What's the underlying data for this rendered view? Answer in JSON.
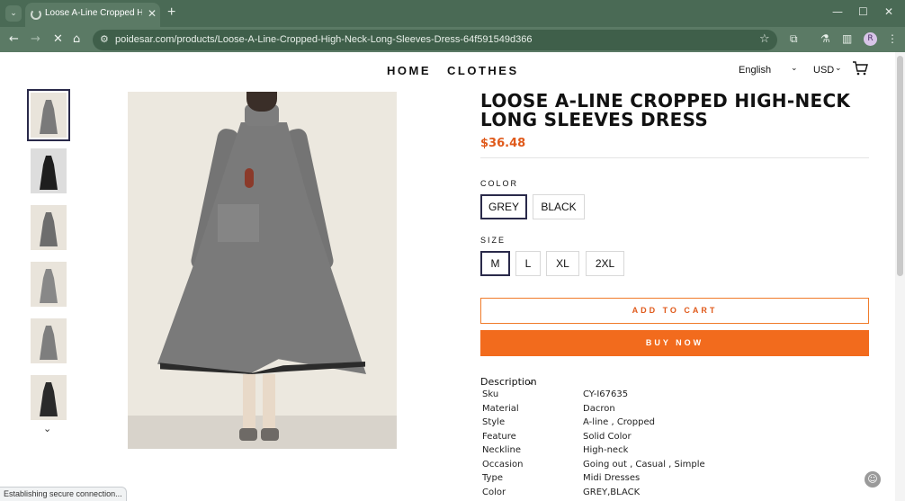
{
  "browser": {
    "tab_title": "Loose A-Line Cropped High-N",
    "tab_close": "✕",
    "new_tab": "+",
    "url": "poidesar.com/products/Loose-A-Line-Cropped-High-Neck-Long-Sleeves-Dress-64f591549d366",
    "profile_initial": "R",
    "status_text": "Establishing secure connection..."
  },
  "nav": {
    "items": [
      "HOME",
      "CLOTHES"
    ],
    "language": "English",
    "currency": "USD"
  },
  "product": {
    "title": "LOOSE A-LINE CROPPED HIGH-NECK LONG SLEEVES DRESS",
    "price": "$36.48",
    "color_label": "COLOR",
    "colors": [
      "GREY",
      "BLACK"
    ],
    "selected_color": "GREY",
    "size_label": "SIZE",
    "sizes": [
      "M",
      "L",
      "XL",
      "2XL"
    ],
    "selected_size": "M",
    "add_to_cart": "ADD TO CART",
    "buy_now": "BUY NOW",
    "description_label": "Description",
    "specs": [
      {
        "key": "Sku",
        "value": "CY-I67635"
      },
      {
        "key": "Material",
        "value": "Dacron"
      },
      {
        "key": "Style",
        "value": "A-line , Cropped"
      },
      {
        "key": "Feature",
        "value": "Solid Color"
      },
      {
        "key": "Neckline",
        "value": "High-neck"
      },
      {
        "key": "Occasion",
        "value": "Going out , Casual , Simple"
      },
      {
        "key": "Type",
        "value": "Midi Dresses"
      },
      {
        "key": "Color",
        "value": "GREY,BLACK"
      }
    ]
  },
  "colors": {
    "accent": "#f26b1d",
    "price": "#e05a1b",
    "chrome": "#5b7a65"
  }
}
